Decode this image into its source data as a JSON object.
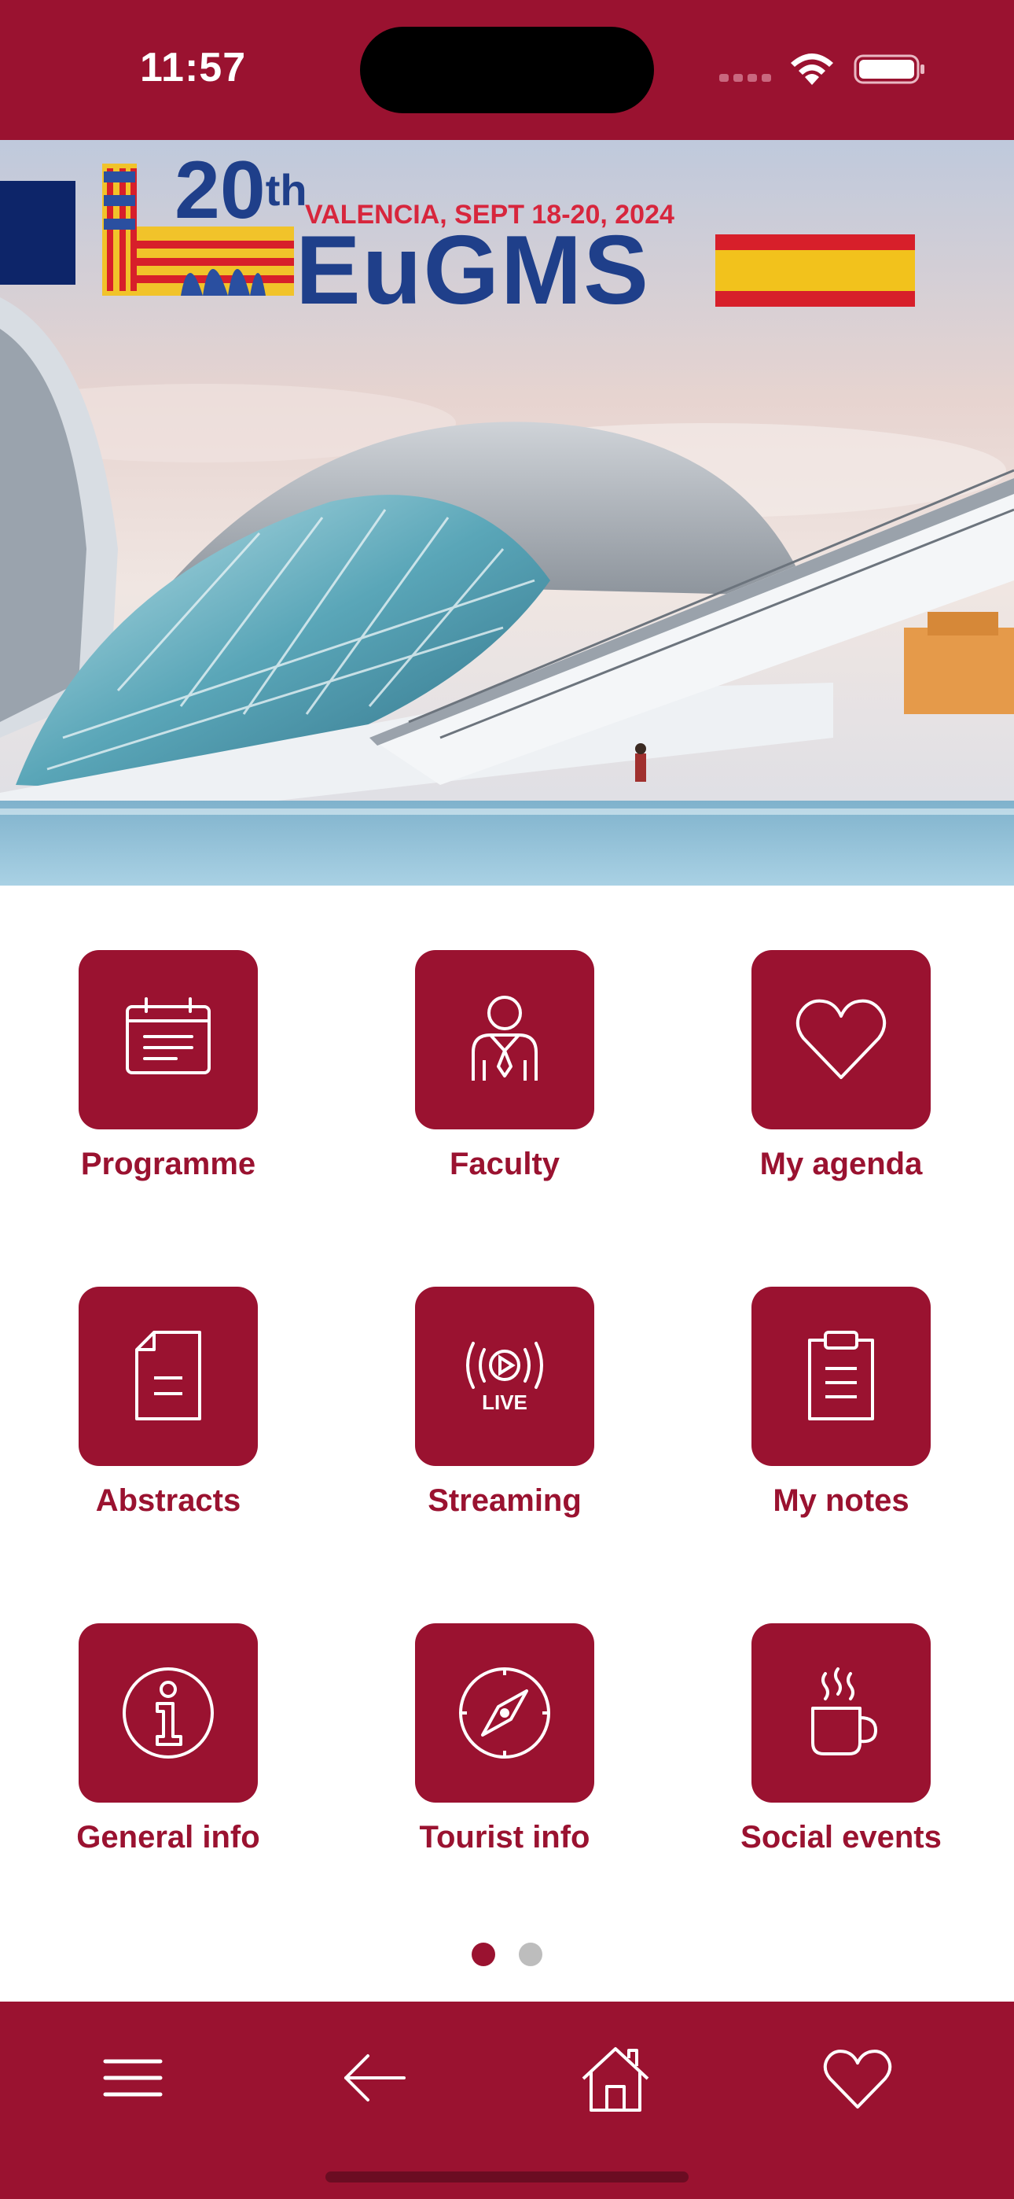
{
  "status_bar": {
    "time": "11:57"
  },
  "banner": {
    "edition": "20",
    "edition_suffix": "th",
    "location_dates": "VALENCIA, SEPT 18-20, 2024",
    "name": "EuGMS"
  },
  "menu": [
    {
      "label": "Programme",
      "icon": "calendar-icon"
    },
    {
      "label": "Faculty",
      "icon": "person-tie-icon"
    },
    {
      "label": "My agenda",
      "icon": "heart-icon"
    },
    {
      "label": "Abstracts",
      "icon": "document-icon"
    },
    {
      "label": "Streaming",
      "icon": "live-stream-icon",
      "icon_text": "LIVE"
    },
    {
      "label": "My notes",
      "icon": "clipboard-icon"
    },
    {
      "label": "General info",
      "icon": "info-icon"
    },
    {
      "label": "Tourist info",
      "icon": "compass-icon"
    },
    {
      "label": "Social events",
      "icon": "coffee-cup-icon"
    }
  ],
  "pager": {
    "page_count": 2,
    "current_page": 1
  },
  "bottom_nav": [
    {
      "icon": "hamburger-menu-icon"
    },
    {
      "icon": "back-arrow-icon"
    },
    {
      "icon": "home-icon"
    },
    {
      "icon": "heart-outline-icon"
    }
  ],
  "colors": {
    "brand": "#9a1230",
    "dot_active": "#9a1230",
    "dot_inactive": "#bdbdbd",
    "banner_blue": "#1f3f8a"
  }
}
